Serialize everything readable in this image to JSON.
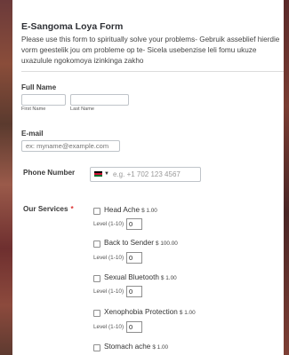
{
  "form": {
    "title": "E-Sangoma Loya Form",
    "description": "Please use this form to spiritually solve your problems- Gebruik asseblief hierdie vorm geestelik jou om probleme op te- Sicela usebenzise leli fomu ukuze uxazulule ngokomoya izinkinga zakho"
  },
  "full_name": {
    "label": "Full Name",
    "first_sublabel": "First Name",
    "last_sublabel": "Last Name",
    "first_value": "",
    "last_value": ""
  },
  "email": {
    "label": "E-mail",
    "placeholder": "ex: myname@example.com"
  },
  "phone": {
    "label": "Phone Number",
    "placeholder": "e.g. +1 702 123 4567",
    "flag_icon": "kenya-flag-icon"
  },
  "services": {
    "label": "Our Services",
    "required_mark": "*",
    "level_label": "Level (1-10)",
    "items": [
      {
        "name": "Head Ache",
        "price": "$ 1.00",
        "level": "0"
      },
      {
        "name": "Back to Sender",
        "price": "$ 100.00",
        "level": "0"
      },
      {
        "name": "Sexual Bluetooth",
        "price": "$ 1.00",
        "level": "0"
      },
      {
        "name": "Xenophobia Protection",
        "price": "$ 1.00",
        "level": "0"
      },
      {
        "name": "Stomach ache",
        "price": "$ 1.00",
        "level": ""
      }
    ]
  },
  "colors": {
    "background": "#7a3a3a",
    "card": "#ffffff",
    "required": "#dd3333"
  }
}
